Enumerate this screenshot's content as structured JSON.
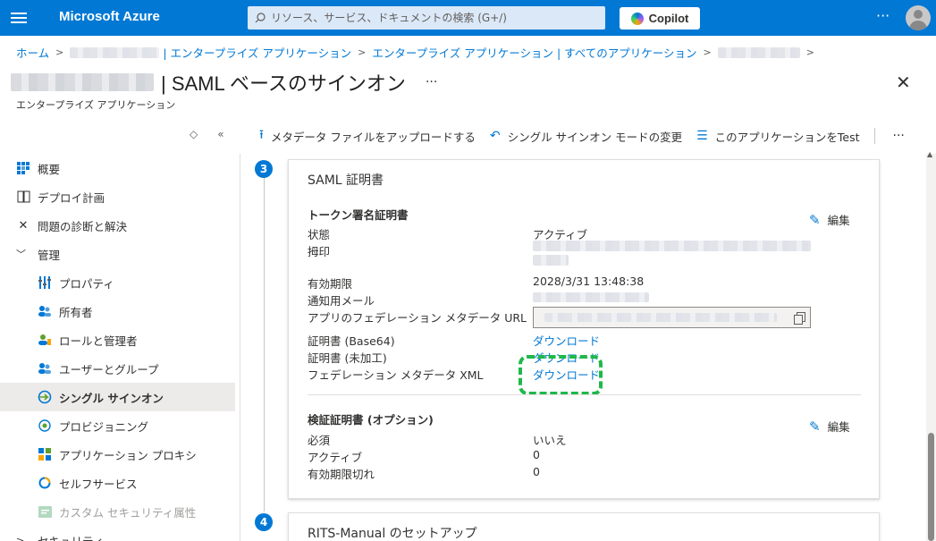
{
  "topbar": {
    "brand": "Microsoft Azure",
    "search_placeholder": "リソース、サービス、ドキュメントの検索 (G+/)",
    "copilot_label": "Copilot",
    "more": "···"
  },
  "breadcrumb": {
    "home": "ホーム",
    "enterprise_apps_1": "| エンタープライズ アプリケーション",
    "enterprise_apps_all": "エンタープライズ アプリケーション | すべてのアプリケーション"
  },
  "header": {
    "title": "| SAML ベースのサインオン",
    "subtitle": "エンタープライズ アプリケーション",
    "more": "···",
    "close": "✕"
  },
  "nav_tools": {
    "sort": "◇",
    "collapse": "«"
  },
  "sidebar": {
    "items": [
      {
        "label": "概要",
        "icon": "grid-icon"
      },
      {
        "label": "デプロイ計画",
        "icon": "book-icon"
      },
      {
        "label": "問題の診断と解決",
        "icon": "wrench-icon"
      },
      {
        "label": "管理",
        "icon": "chevron-down-icon"
      },
      {
        "label": "プロパティ",
        "icon": "properties-icon"
      },
      {
        "label": "所有者",
        "icon": "owners-icon"
      },
      {
        "label": "ロールと管理者",
        "icon": "roles-icon"
      },
      {
        "label": "ユーザーとグループ",
        "icon": "users-groups-icon"
      },
      {
        "label": "シングル サインオン",
        "icon": "sso-icon"
      },
      {
        "label": "プロビジョニング",
        "icon": "provisioning-icon"
      },
      {
        "label": "アプリケーション プロキシ",
        "icon": "app-proxy-icon"
      },
      {
        "label": "セルフサービス",
        "icon": "self-service-icon"
      },
      {
        "label": "カスタム セキュリティ属性",
        "icon": "custom-attr-icon"
      },
      {
        "label": "セキュリティ",
        "icon": "chevron-right-icon"
      }
    ]
  },
  "toolbar": {
    "upload_metadata": "メタデータ ファイルをアップロードする",
    "change_sso_mode": "シングル サインオン モードの変更",
    "test_app": "このアプリケーションをTest",
    "more": "···"
  },
  "steps": {
    "step3": "3",
    "step4": "4"
  },
  "saml_card": {
    "title": "SAML 証明書",
    "token_section": "トークン署名証明書",
    "edit": "編集",
    "labels": {
      "status": "状態",
      "thumbprint": "拇印",
      "expiration": "有効期限",
      "notification_email": "通知用メール",
      "metadata_url": "アプリのフェデレーション メタデータ URL",
      "cert_base64": "証明書 (Base64)",
      "cert_raw": "証明書 (未加工)",
      "federation_xml": "フェデレーション メタデータ XML"
    },
    "values": {
      "status": "アクティブ",
      "expiration": "2028/3/31 13:48:38",
      "download_base64": "ダウンロード",
      "download_raw": "ダウンロード",
      "download_xml": "ダウンロード"
    },
    "verify_section": "検証証明書 (オプション)",
    "verify_edit": "編集",
    "verify_labels": {
      "required": "必須",
      "active": "アクティブ",
      "expired": "有効期限切れ"
    },
    "verify_values": {
      "required": "いいえ",
      "active": "0",
      "expired": "0"
    }
  },
  "setup_card": {
    "title": "RITS-Manual のセットアップ"
  },
  "colors": {
    "accent": "#0078d4",
    "highlight": "#1fb84a"
  }
}
